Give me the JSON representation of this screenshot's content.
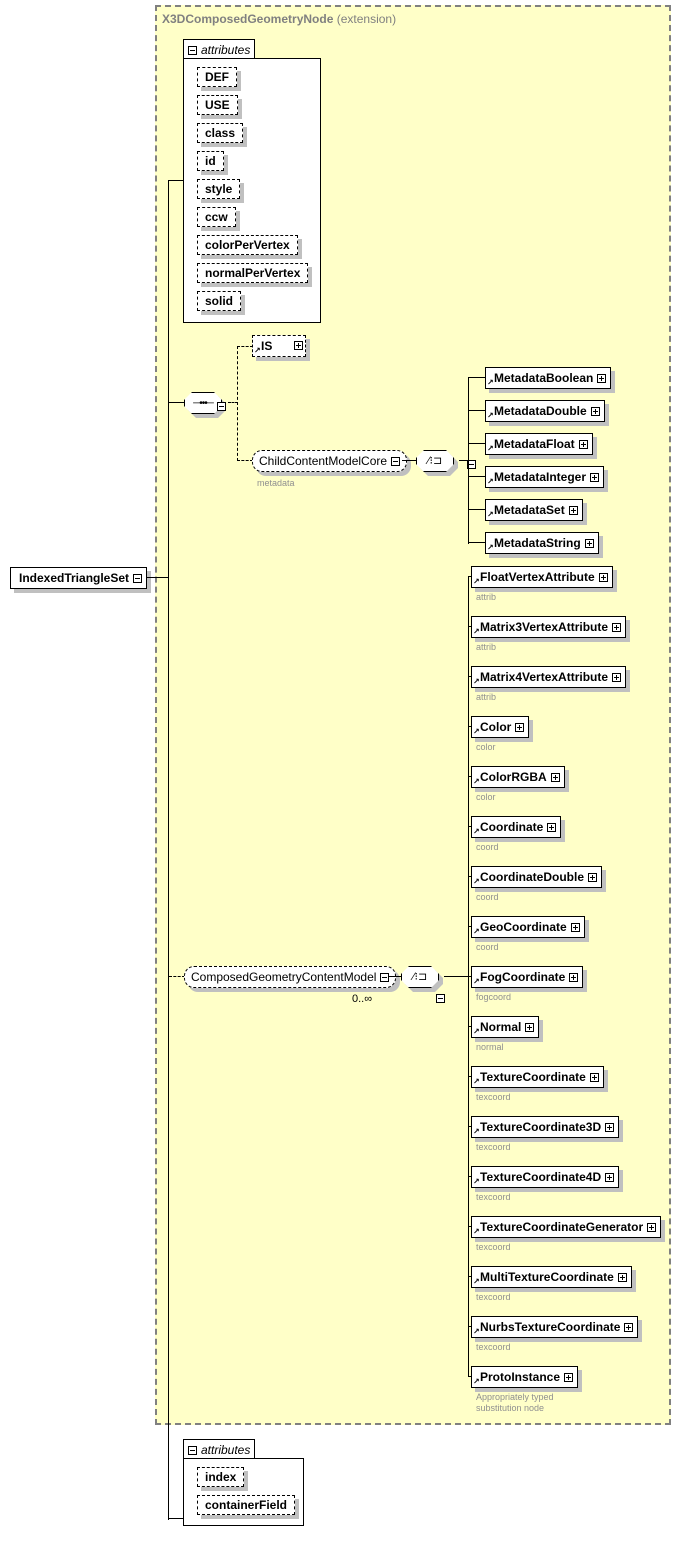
{
  "root": {
    "label": "IndexedTriangleSet"
  },
  "extension": {
    "base": "X3DComposedGeometryNode",
    "suffix": "(extension)"
  },
  "base_attributes": {
    "label": "attributes",
    "items": [
      "DEF",
      "USE",
      "class",
      "id",
      "style",
      "ccw",
      "colorPerVertex",
      "normalPerVertex",
      "solid"
    ]
  },
  "sequence": {
    "is_element": {
      "label": "IS"
    },
    "child_group": {
      "label": "ChildContentModelCore",
      "sub": "metadata"
    },
    "metadata_items": [
      "MetadataBoolean",
      "MetadataDouble",
      "MetadataFloat",
      "MetadataInteger",
      "MetadataSet",
      "MetadataString"
    ]
  },
  "composed_group": {
    "label": "ComposedGeometryContentModel",
    "occurrence": "0..∞",
    "items": [
      {
        "label": "FloatVertexAttribute",
        "sub": "attrib"
      },
      {
        "label": "Matrix3VertexAttribute",
        "sub": "attrib"
      },
      {
        "label": "Matrix4VertexAttribute",
        "sub": "attrib"
      },
      {
        "label": "Color",
        "sub": "color"
      },
      {
        "label": "ColorRGBA",
        "sub": "color"
      },
      {
        "label": "Coordinate",
        "sub": "coord"
      },
      {
        "label": "CoordinateDouble",
        "sub": "coord"
      },
      {
        "label": "GeoCoordinate",
        "sub": "coord"
      },
      {
        "label": "FogCoordinate",
        "sub": "fogcoord"
      },
      {
        "label": "Normal",
        "sub": "normal"
      },
      {
        "label": "TextureCoordinate",
        "sub": "texcoord"
      },
      {
        "label": "TextureCoordinate3D",
        "sub": "texcoord"
      },
      {
        "label": "TextureCoordinate4D",
        "sub": "texcoord"
      },
      {
        "label": "TextureCoordinateGenerator",
        "sub": "texcoord"
      },
      {
        "label": "MultiTextureCoordinate",
        "sub": "texcoord"
      },
      {
        "label": "NurbsTextureCoordinate",
        "sub": "texcoord"
      },
      {
        "label": "ProtoInstance",
        "sub": "Appropriately typed\nsubstitution node"
      }
    ]
  },
  "own_attributes": {
    "label": "attributes",
    "items": [
      "index",
      "containerField"
    ]
  },
  "colors": {
    "extension_bg": "#ffffc8",
    "extension_border": "#808080",
    "shadow": "#c0c0c0",
    "sub_text": "#909090"
  }
}
